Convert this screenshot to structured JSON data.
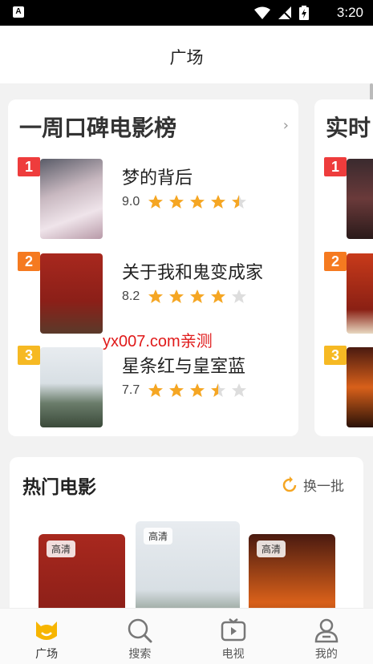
{
  "status_bar": {
    "app_badge": "A",
    "time": "3:20"
  },
  "header": {
    "title": "广场"
  },
  "ranking_card": {
    "title": "一周口碑电影榜",
    "items": [
      {
        "rank": "1",
        "name": "梦的背后",
        "score": "9.0",
        "stars": 4.5
      },
      {
        "rank": "2",
        "name": "关于我和鬼变成家",
        "score": "8.2",
        "stars": 4
      },
      {
        "rank": "3",
        "name": "星条红与皇室蓝",
        "score": "7.7",
        "stars": 3.5
      }
    ]
  },
  "realtime_card": {
    "title": "实时",
    "ranks": [
      "1",
      "2",
      "3"
    ]
  },
  "watermark": "yx007.com亲测",
  "hot_movies": {
    "title": "热门电影",
    "refresh_label": "换一批",
    "hd_label": "高清"
  },
  "bottom_nav": [
    {
      "label": "广场",
      "icon": "home-icon",
      "active": true
    },
    {
      "label": "搜索",
      "icon": "search-icon",
      "active": false
    },
    {
      "label": "电视",
      "icon": "tv-icon",
      "active": false
    },
    {
      "label": "我的",
      "icon": "profile-icon",
      "active": false
    }
  ],
  "colors": {
    "star": "#f5a623",
    "star_empty": "#dddddd",
    "rank1": "#ee3c3c",
    "rank2": "#f57a20",
    "rank3": "#f6b923",
    "watermark": "#e01a1a"
  }
}
